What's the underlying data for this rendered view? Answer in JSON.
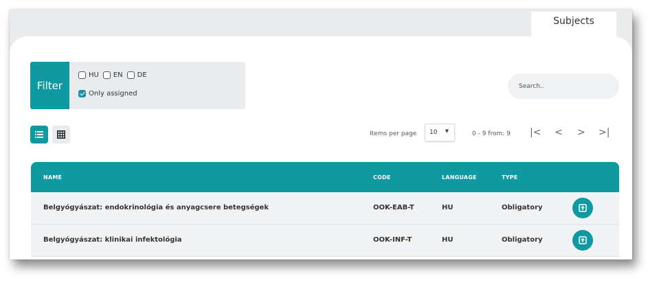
{
  "tab": {
    "label": "Subjects"
  },
  "filter": {
    "label": "Filter",
    "languages": [
      {
        "code": "HU",
        "checked": false
      },
      {
        "code": "EN",
        "checked": false
      },
      {
        "code": "DE",
        "checked": false
      }
    ],
    "only_assigned": {
      "label": "Only assigned",
      "checked": true
    }
  },
  "search": {
    "placeholder": "Search.."
  },
  "view": {
    "list_icon": "list-view-icon",
    "grid_icon": "grid-view-icon",
    "active": "list"
  },
  "pager": {
    "items_per_page_label": "Items per page",
    "items_per_page": "10",
    "range": "0 - 9 from: 9",
    "first": "|<",
    "prev": "<",
    "next": ">",
    "last": ">|"
  },
  "table": {
    "columns": [
      "NAME",
      "CODE",
      "LANGUAGE",
      "TYPE"
    ],
    "rows": [
      {
        "name": "Belgyógyászat: endokrinológia és anyagcsere betegségek",
        "code": "OOK-EAB-T",
        "language": "HU",
        "type": "Obligatory"
      },
      {
        "name": "Belgyógyászat: klinikai infektológia",
        "code": "OOK-INF-T",
        "language": "HU",
        "type": "Obligatory"
      }
    ]
  },
  "colors": {
    "accent": "#0f9aa1",
    "background": "#e9ebed",
    "row": "#f1f2f4"
  }
}
